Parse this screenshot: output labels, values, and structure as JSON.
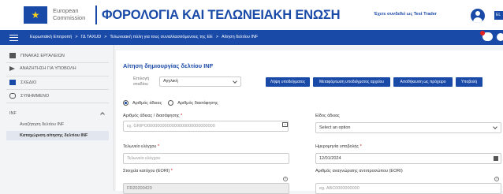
{
  "header": {
    "org_line1": "European",
    "org_line2": "Commission",
    "site_title": "ΦΟΡΟΛΟΓΙΑ ΚΑΙ ΤΕΛΩΝΕΙΑΚΗ ΕΝΩΣΗ",
    "login_text": "Έχετε συνδεθεί ως Test Trader",
    "lang": "EL"
  },
  "breadcrumbs": [
    "Ευρωπαϊκή Επιτροπή",
    ">",
    "ΓΔ TAXUD",
    ">",
    "Τελωνειακή πύλη για τους συναλλασσόμενους της ΕΕ",
    ">",
    "Αίτηση δελτίου INF"
  ],
  "sidebar": {
    "items": [
      {
        "label": "ΠΙΝΑΚΑΣ ΕΡΓΑΛΕΙΩΝ",
        "icon": "dashboard-icon"
      },
      {
        "label": "ΑΝΑΖΗΤΗΣΗ ΓΙΑ ΥΠΟΒΟΛΗ",
        "icon": "send-icon"
      },
      {
        "label": "ΣΧΕΔΙΟ",
        "icon": "draft-icon"
      },
      {
        "label": "ΣΥΝΗΜΜΕΝΟ",
        "icon": "paperclip-icon"
      }
    ],
    "section": "INF",
    "sub_items": [
      "Αναζήτηση δελτίου INF",
      "Καταχώριση αίτησης δελτίου INF"
    ]
  },
  "main": {
    "title": "Αίτηση δημιουργίας δελτίου INF",
    "stage_label": "Επιλογή σταδίου",
    "stage_value": "Αγγλική",
    "buttons": [
      "Λήψη υποδείγματος",
      "Μεταφόρτωση υποδείγματος αρχείου",
      "Αποθήκευση ως πρόχειρο",
      "Υποβολή"
    ],
    "radios": [
      "Αριθμός άδειας",
      "Αριθμός διασάφησης"
    ],
    "fields": {
      "permit_number_label": "Αριθμός άδειας / διασάφησης",
      "permit_number_placeholder": "εχ. GRIPO0000000000000000000000000000",
      "permit_type_label": "Είδος άδειας",
      "permit_type_value": "Select an option",
      "customs_office_label": "Τελωνείο ελέγχου",
      "customs_office_placeholder": "Τελωνείο ελέγχου",
      "submission_date_label": "Ημερομηνία υποβολής",
      "submission_date_value": "12/01/2024",
      "eori_label": "Στοιχεία κατόχου (EORI)",
      "eori_value": "FR20200420",
      "rep_label": "Αριθμός αναγνώρισης αντιπροσώπου (EORI)",
      "rep_placeholder": "eg.  ABC0000000000"
    }
  }
}
